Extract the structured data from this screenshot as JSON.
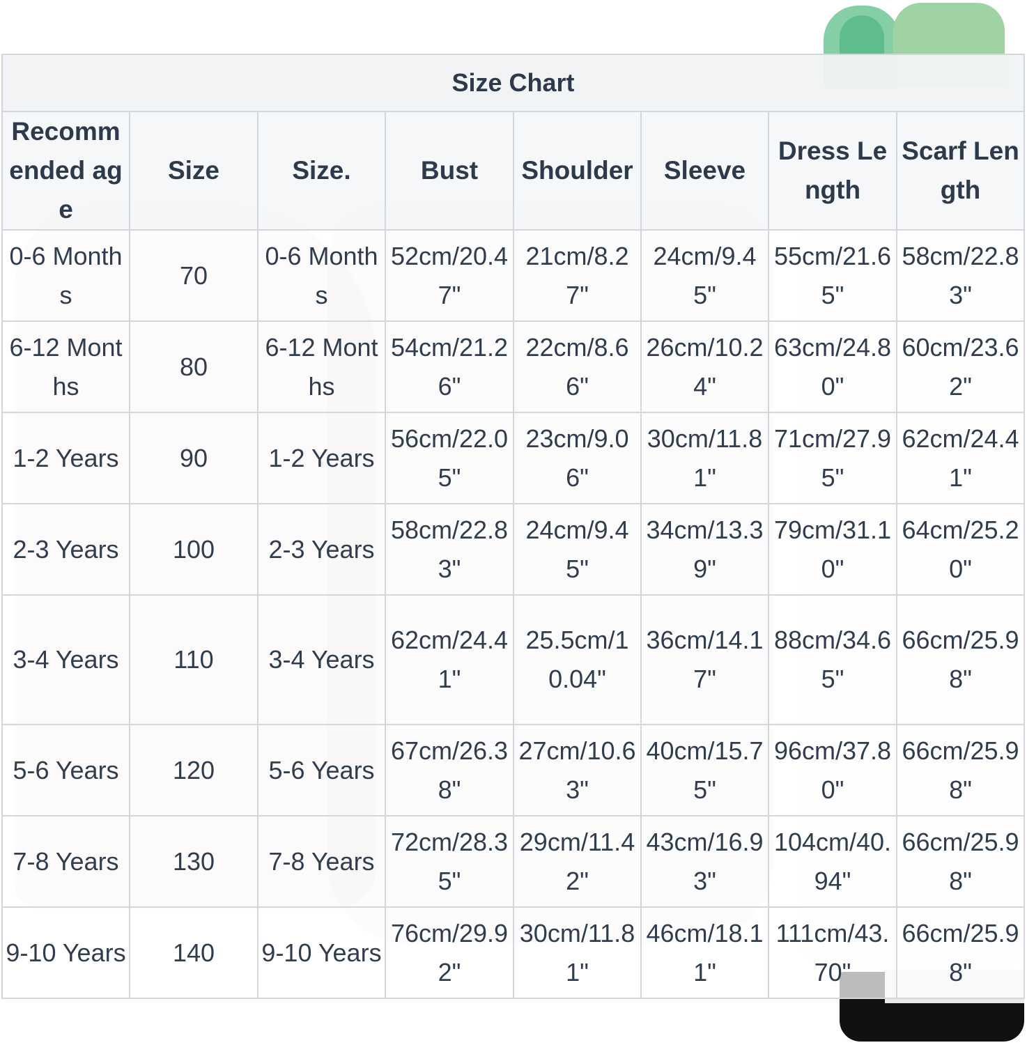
{
  "table": {
    "title": "Size Chart",
    "headers": [
      "Recommended age",
      "Size",
      "Size.",
      "Bust",
      "Shoulder",
      "Sleeve",
      "Dress Length",
      "Scarf Length"
    ],
    "rows": [
      [
        "0-6 Months",
        "70",
        "0-6 Months",
        "52cm/20.47\"",
        "21cm/8.27\"",
        "24cm/9.45\"",
        "55cm/21.65\"",
        "58cm/22.83\""
      ],
      [
        "6-12 Months",
        "80",
        "6-12 Months",
        "54cm/21.26\"",
        "22cm/8.66\"",
        "26cm/10.24\"",
        "63cm/24.80\"",
        "60cm/23.62\""
      ],
      [
        "1-2 Years",
        "90",
        "1-2 Years",
        "56cm/22.05\"",
        "23cm/9.06\"",
        "30cm/11.81\"",
        "71cm/27.95\"",
        "62cm/24.41\""
      ],
      [
        "2-3 Years",
        "100",
        "2-3 Years",
        "58cm/22.83\"",
        "24cm/9.45\"",
        "34cm/13.39\"",
        "79cm/31.10\"",
        "64cm/25.20\""
      ],
      [
        "3-4 Years",
        "110",
        "3-4 Years",
        "62cm/24.41\"",
        "25.5cm/10.04\"",
        "36cm/14.17\"",
        "88cm/34.65\"",
        "66cm/25.98\""
      ],
      [
        "5-6 Years",
        "120",
        "5-6 Years",
        "67cm/26.38\"",
        "27cm/10.63\"",
        "40cm/15.75\"",
        "96cm/37.80\"",
        "66cm/25.98\""
      ],
      [
        "7-8 Years",
        "130",
        "7-8 Years",
        "72cm/28.35\"",
        "29cm/11.42\"",
        "43cm/16.93\"",
        "104cm/40.94\"",
        "66cm/25.98\""
      ],
      [
        "9-10 Years",
        "140",
        "9-10 Years",
        "76cm/29.92\"",
        "30cm/11.81\"",
        "46cm/18.11\"",
        "111cm/43.70\"",
        "66cm/25.98\""
      ]
    ]
  }
}
